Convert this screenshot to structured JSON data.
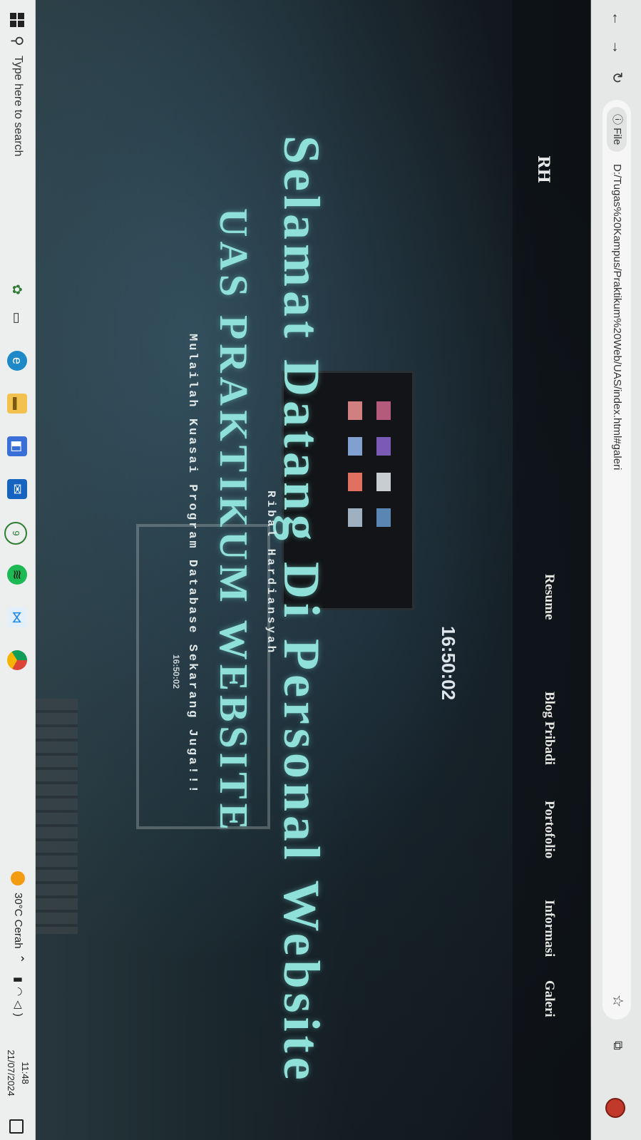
{
  "browser": {
    "info_label": "File",
    "url": "D:/Tugas%20Kampus/Praktikum%20Web/UAS/index.html#galeri"
  },
  "nav": {
    "logo_text": "RH",
    "items": [
      {
        "label": "Resume"
      },
      {
        "label": "Blog Pribadi"
      },
      {
        "label": "Portofolio"
      },
      {
        "label": "Informasi"
      },
      {
        "label": "Galeri"
      }
    ]
  },
  "hero": {
    "clock_large": "16:50:02",
    "title": "Selamat Datang Di Personal Website",
    "author": "Ribal Hardiansyah",
    "subtitle": "UAS PRAKTIKUM WEBSITE",
    "tagline": "Mulailah Kuasai Program Database Sekarang Juga!!!",
    "clock_small": "16:50:02"
  },
  "taskbar": {
    "search_placeholder": "Type here to search",
    "pinned_apps": [
      "widgets-icon",
      "task-view-icon",
      "edge-icon",
      "file-explorer-icon",
      "store-icon",
      "mail-icon",
      "whatsapp-icon",
      "spotify-icon",
      "vscode-icon",
      "chrome-icon"
    ],
    "whatsapp_badge": "9",
    "weather": "30°C  Cerah",
    "time": "11:48",
    "date": "21/07/2024"
  },
  "colors": {
    "accent": "#8fe0d8",
    "chrome_bg": "#e6e8e7",
    "taskbar_bg": "#ecefee"
  }
}
